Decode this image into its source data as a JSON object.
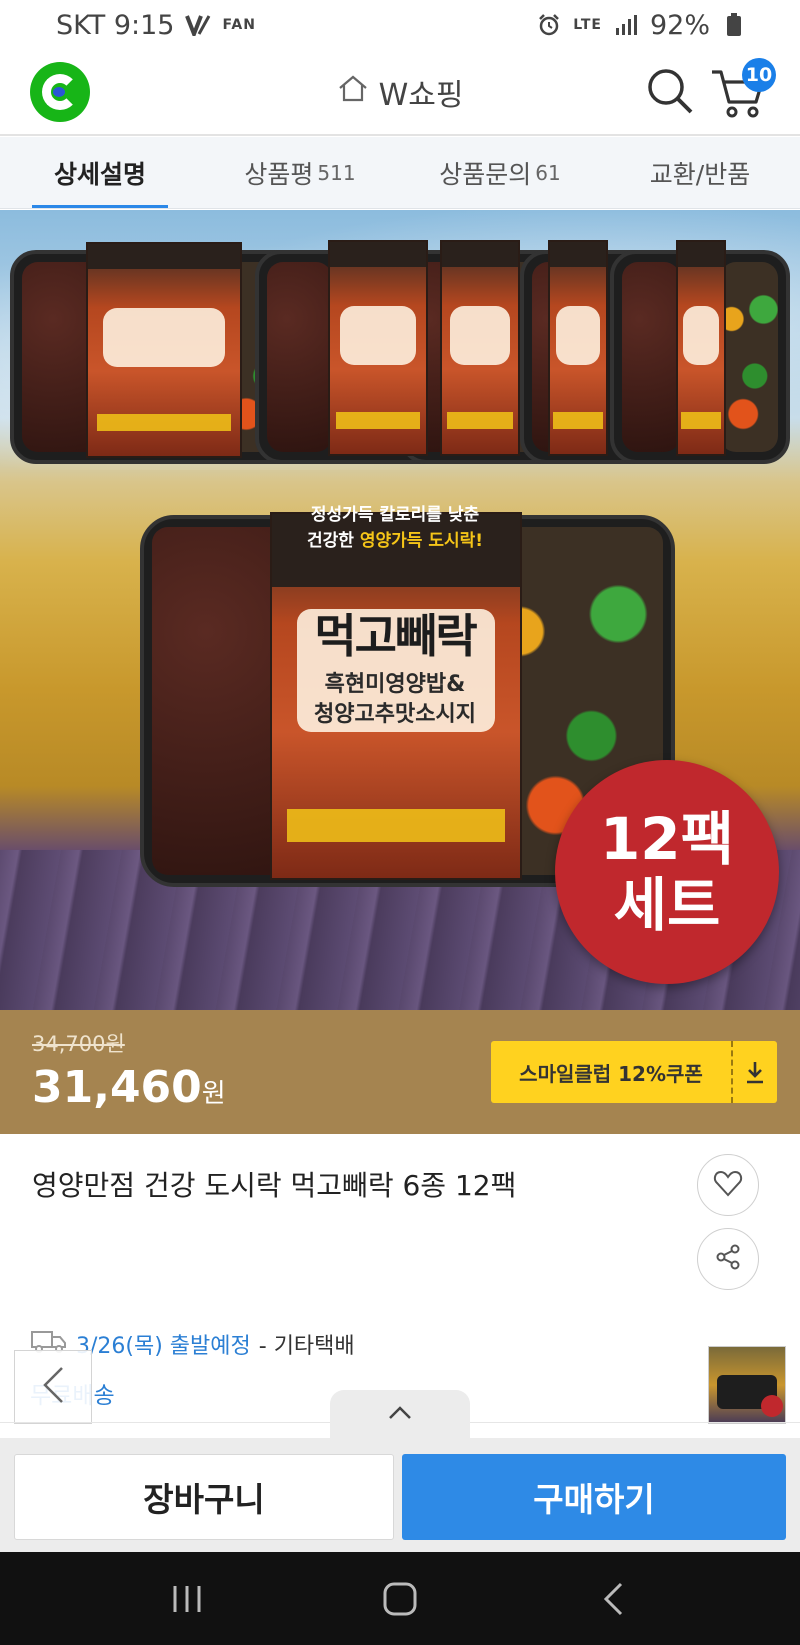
{
  "status_bar": {
    "carrier_time": "SKT 9:15",
    "fan_label": "FAN",
    "network": "LTE",
    "battery": "92%"
  },
  "header": {
    "title": "W쇼핑",
    "cart_count": "10"
  },
  "tabs": [
    {
      "label": "상세설명",
      "count": ""
    },
    {
      "label": "상품평",
      "count": "511"
    },
    {
      "label": "상품문의",
      "count": "61"
    },
    {
      "label": "교환/반품",
      "count": ""
    }
  ],
  "product_image": {
    "sleeve_line1": "정성가득 칼로리를 낮춘",
    "sleeve_line2_prefix": "건강한",
    "sleeve_line2_highlight": "영양가득 도시락!",
    "brand": "먹고빼락",
    "sub_line1": "흑현미영양밥&",
    "sub_line2": "청양고추맛소시지",
    "badge_line1": "12팩",
    "badge_line2": "세트"
  },
  "price": {
    "original": "34,700원",
    "sale": "31,460",
    "unit": "원",
    "coupon_label": "스마일클럽 12%쿠폰"
  },
  "product": {
    "title": "영양만점 건강 도시락 먹고빼락 6종 12팩"
  },
  "shipping": {
    "date": "3/26(목) 출발예정",
    "method": "- 기타택배",
    "free": "무료배송"
  },
  "actions": {
    "cart": "장바구니",
    "buy": "구매하기"
  },
  "colors": {
    "accent_blue": "#2e8ae6",
    "price_bar": "#a58450",
    "coupon": "#ffd21f",
    "logo_green": "#17b517"
  }
}
